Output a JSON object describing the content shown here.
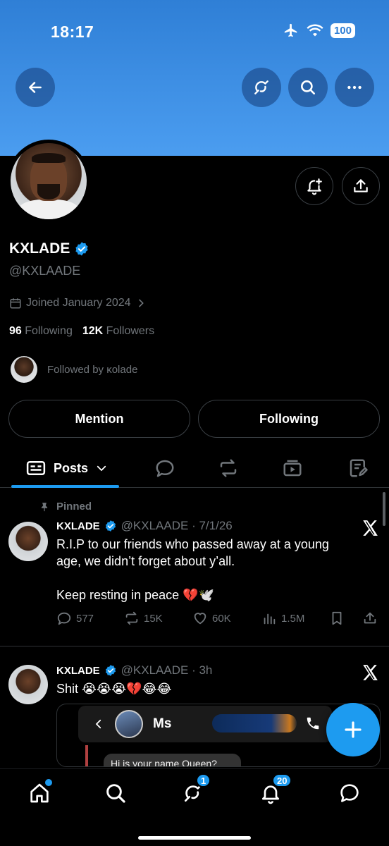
{
  "status_bar": {
    "time": "18:17",
    "battery": "100"
  },
  "profile": {
    "display_name": "KXLADE",
    "handle": "@KXLAADE",
    "joined": "Joined January 2024",
    "following_count": "96",
    "following_label": "Following",
    "followers_count": "12K",
    "followers_label": "Followers",
    "followed_by": "Followed by κolade"
  },
  "actions": {
    "mention_label": "Mention",
    "following_label": "Following"
  },
  "tabs": {
    "active_label": "Posts"
  },
  "posts": [
    {
      "pinned_label": "Pinned",
      "name": "KXLADE",
      "meta": "@KXLAADE · 7/1/26",
      "text_line1": "R.I.P to our friends who passed away at a young",
      "text_line2": "age, we didn’t forget about y’all.",
      "text_line3": "Keep resting in peace 💔🕊️",
      "replies": "577",
      "reposts": "15K",
      "likes": "60K",
      "views": "1.5M"
    },
    {
      "name": "KXLADE",
      "meta": "@KXLAADE · 3h",
      "text": "Shit 😭😭😭💔😂😂",
      "embed_name": "Ms",
      "embed_bubble": "Hi is your name Queen?"
    }
  ],
  "bottom_nav": {
    "grok_badge": "1",
    "notifications_badge": "20"
  },
  "colors": {
    "accent": "#1d9bf0",
    "banner_top": "#2f7fd6",
    "banner_bottom": "#4b9df0",
    "muted": "#71767b"
  }
}
